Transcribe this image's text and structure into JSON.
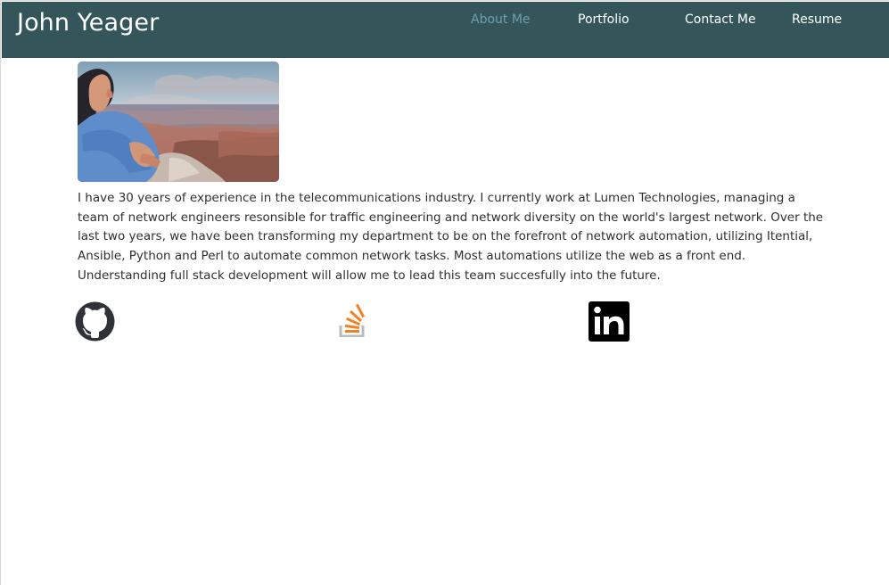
{
  "site": {
    "name": "John Yeager"
  },
  "nav": [
    {
      "label": "About Me",
      "active": true
    },
    {
      "label": "Portfolio",
      "active": false
    },
    {
      "label": "Contact Me",
      "active": false
    },
    {
      "label": "Resume",
      "active": false
    }
  ],
  "about": {
    "bio": "I have 30 years of experience in the telecommunications industry. I currently work at Lumen Technologies, managing a team of network engineers resonsible for traffic engineering and network diversity on the world's largest network. Over the last two years, we have been transforming my department to be on the forefront of network automation, utilizing Itential, Ansible, Python and Perl to automate common network tasks. Most automations utilize the web as a front end. Understanding full stack development will allow me to lead this team succesfully into the future."
  },
  "social": [
    {
      "icon": "github-icon"
    },
    {
      "icon": "stack-overflow-icon"
    },
    {
      "icon": "linkedin-icon"
    }
  ],
  "colors": {
    "header_background": "#34565a",
    "active_nav": "#6f9fb0",
    "body_text": "#2f2f2f",
    "stack_overflow_orange": "#f48024",
    "stack_overflow_gray": "#bcbbbb"
  }
}
